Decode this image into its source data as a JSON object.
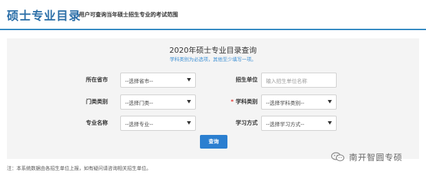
{
  "header": {
    "title": "硕士专业目录",
    "subtitle": "用户可查询当年硕士招生专业的考试范围"
  },
  "panel": {
    "title": "2020年硕士专业目录查询",
    "hint": "学科类别为必选项，其他至少填写一项。"
  },
  "form": {
    "province": {
      "label": "所在省市",
      "value": "--选择省市--"
    },
    "school": {
      "label": "招生单位",
      "placeholder": "输入招生单位名称"
    },
    "category": {
      "label": "门类类别",
      "value": "--选择门类--"
    },
    "subject": {
      "label": "学科类别",
      "required_mark": "*",
      "value": "--选择学科类别--"
    },
    "major": {
      "label": "专业名称",
      "value": "--选择专业--"
    },
    "mode": {
      "label": "学习方式",
      "value": "--选择学习方式--"
    },
    "submit_label": "查询"
  },
  "footer": {
    "note": "注：本系统数据由各招生单位上报，如有疑问请咨询相关招生单位。"
  },
  "watermark": {
    "text": "南开智圆专硕"
  },
  "colors": {
    "accent": "#2e86c1",
    "button": "#2b7fd0",
    "required": "#e53935"
  }
}
